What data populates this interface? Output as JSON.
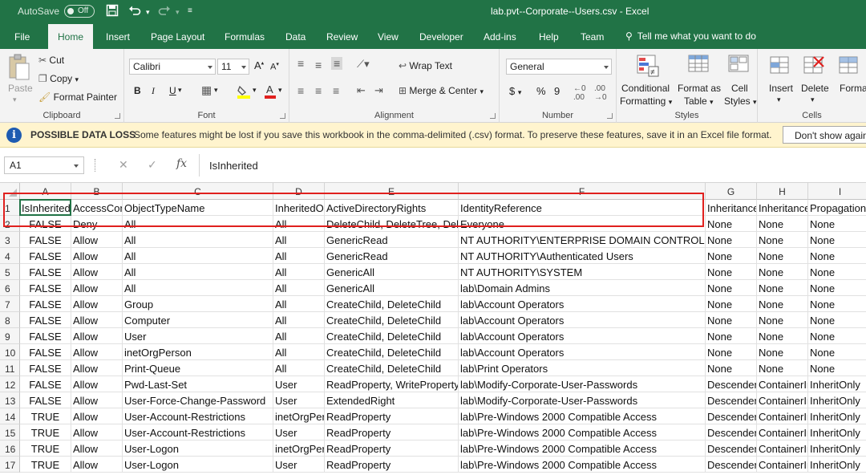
{
  "app": {
    "autosave_label": "AutoSave",
    "autosave_state": "Off",
    "window_title": "lab.pvt--Corporate--Users.csv  -  Excel",
    "accent_color": "#217346"
  },
  "tabs": [
    "File",
    "Home",
    "Insert",
    "Page Layout",
    "Formulas",
    "Data",
    "Review",
    "View",
    "Developer",
    "Add-ins",
    "Help",
    "Team"
  ],
  "active_tab": "Home",
  "tell_me": "Tell me what you want to do",
  "ribbon": {
    "clipboard": {
      "paste": "Paste",
      "cut": "Cut",
      "copy": "Copy",
      "format_painter": "Format Painter",
      "label": "Clipboard"
    },
    "font": {
      "name": "Calibri",
      "size": "11",
      "bold": "B",
      "italic": "I",
      "underline": "U",
      "label": "Font"
    },
    "alignment": {
      "wrap_text": "Wrap Text",
      "merge_center": "Merge & Center",
      "label": "Alignment"
    },
    "number": {
      "format": "General",
      "currency": "$",
      "percent": "%",
      "comma": "9",
      "label": "Number"
    },
    "styles": {
      "conditional": "Conditional",
      "conditional2": "Formatting",
      "format_as": "Format as",
      "format_as2": "Table",
      "cell": "Cell",
      "cell2": "Styles",
      "label": "Styles"
    },
    "cells": {
      "insert": "Insert",
      "delete": "Delete",
      "format": "Format",
      "label": "Cells"
    }
  },
  "infobar": {
    "title": "POSSIBLE DATA LOSS",
    "message": "Some features might be lost if you save this workbook in the comma-delimited (.csv) format. To preserve these features, save it in an Excel file format.",
    "button": "Don't show again"
  },
  "formula_bar": {
    "name_box": "A1",
    "fx": "fx",
    "value": "IsInherited"
  },
  "grid": {
    "columns": [
      "A",
      "B",
      "C",
      "D",
      "E",
      "F",
      "G",
      "H",
      "I"
    ],
    "row_numbers": [
      "1",
      "2",
      "3",
      "4",
      "5",
      "6",
      "7",
      "8",
      "9",
      "10",
      "11",
      "12",
      "13",
      "14",
      "15",
      "16",
      "17"
    ],
    "rows": [
      [
        "IsInherited",
        "AccessControlType",
        "ObjectTypeName",
        "InheritedObjectTypeName",
        "ActiveDirectoryRights",
        "IdentityReference",
        "InheritanceType",
        "InheritanceFlags",
        "PropagationFlags"
      ],
      [
        "FALSE",
        "Deny",
        "All",
        "All",
        "DeleteChild, DeleteTree, Delete",
        "Everyone",
        "None",
        "None",
        "None"
      ],
      [
        "FALSE",
        "Allow",
        "All",
        "All",
        "GenericRead",
        "NT AUTHORITY\\ENTERPRISE DOMAIN CONTROLLERS",
        "None",
        "None",
        "None"
      ],
      [
        "FALSE",
        "Allow",
        "All",
        "All",
        "GenericRead",
        "NT AUTHORITY\\Authenticated Users",
        "None",
        "None",
        "None"
      ],
      [
        "FALSE",
        "Allow",
        "All",
        "All",
        "GenericAll",
        "NT AUTHORITY\\SYSTEM",
        "None",
        "None",
        "None"
      ],
      [
        "FALSE",
        "Allow",
        "All",
        "All",
        "GenericAll",
        "lab\\Domain Admins",
        "None",
        "None",
        "None"
      ],
      [
        "FALSE",
        "Allow",
        "Group",
        "All",
        "CreateChild, DeleteChild",
        "lab\\Account Operators",
        "None",
        "None",
        "None"
      ],
      [
        "FALSE",
        "Allow",
        "Computer",
        "All",
        "CreateChild, DeleteChild",
        "lab\\Account Operators",
        "None",
        "None",
        "None"
      ],
      [
        "FALSE",
        "Allow",
        "User",
        "All",
        "CreateChild, DeleteChild",
        "lab\\Account Operators",
        "None",
        "None",
        "None"
      ],
      [
        "FALSE",
        "Allow",
        "inetOrgPerson",
        "All",
        "CreateChild, DeleteChild",
        "lab\\Account Operators",
        "None",
        "None",
        "None"
      ],
      [
        "FALSE",
        "Allow",
        "Print-Queue",
        "All",
        "CreateChild, DeleteChild",
        "lab\\Print Operators",
        "None",
        "None",
        "None"
      ],
      [
        "FALSE",
        "Allow",
        "Pwd-Last-Set",
        "User",
        "ReadProperty, WriteProperty",
        "lab\\Modify-Corporate-User-Passwords",
        "Descendents",
        "ContainerInherit",
        "InheritOnly"
      ],
      [
        "FALSE",
        "Allow",
        "User-Force-Change-Password",
        "User",
        "ExtendedRight",
        "lab\\Modify-Corporate-User-Passwords",
        "Descendents",
        "ContainerInherit",
        "InheritOnly"
      ],
      [
        "TRUE",
        "Allow",
        "User-Account-Restrictions",
        "inetOrgPerson",
        "ReadProperty",
        "lab\\Pre-Windows 2000 Compatible Access",
        "Descendents",
        "ContainerInherit",
        "InheritOnly"
      ],
      [
        "TRUE",
        "Allow",
        "User-Account-Restrictions",
        "User",
        "ReadProperty",
        "lab\\Pre-Windows 2000 Compatible Access",
        "Descendents",
        "ContainerInherit",
        "InheritOnly"
      ],
      [
        "TRUE",
        "Allow",
        "User-Logon",
        "inetOrgPerson",
        "ReadProperty",
        "lab\\Pre-Windows 2000 Compatible Access",
        "Descendents",
        "ContainerInherit",
        "InheritOnly"
      ],
      [
        "TRUE",
        "Allow",
        "User-Logon",
        "User",
        "ReadProperty",
        "lab\\Pre-Windows 2000 Compatible Access",
        "Descendents",
        "ContainerInherit",
        "InheritOnly"
      ]
    ],
    "highlighted_rows": [
      "12",
      "13"
    ],
    "highlight_color": "#e0201e"
  }
}
